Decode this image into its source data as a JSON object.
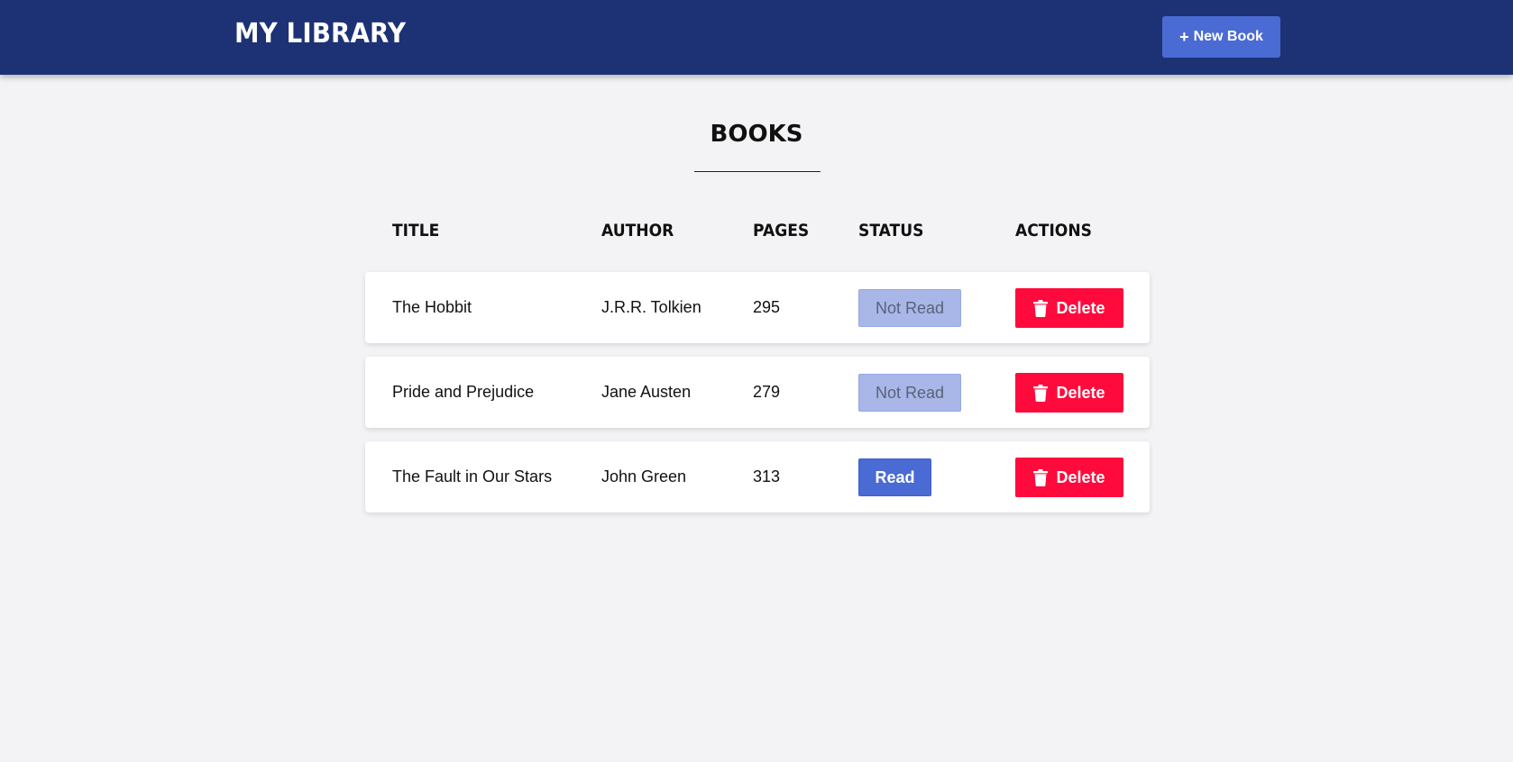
{
  "header": {
    "brand": "MY LIBRARY",
    "new_book_label": "New Book",
    "new_book_icon": "plus-icon",
    "background": "#1d3275",
    "accent": "#4a6bd3"
  },
  "main": {
    "title": "BOOKS",
    "columns": [
      "TITLE",
      "AUTHOR",
      "PAGES",
      "STATUS",
      "ACTIONS"
    ],
    "rows": [
      {
        "title": "The Hobbit",
        "author": "J.R.R. Tolkien",
        "pages": "295",
        "status": "Not Read",
        "action": "Delete"
      },
      {
        "title": "Pride and Prejudice",
        "author": "Jane Austen",
        "pages": "279",
        "status": "Not Read",
        "action": "Delete"
      },
      {
        "title": "The Fault in Our Stars",
        "author": "John Green",
        "pages": "313",
        "status": "Read",
        "action": "Delete"
      }
    ],
    "delete_icon": "trash-icon",
    "delete_color": "#ff0a3c",
    "not_read_color": "#a8b6e8"
  }
}
